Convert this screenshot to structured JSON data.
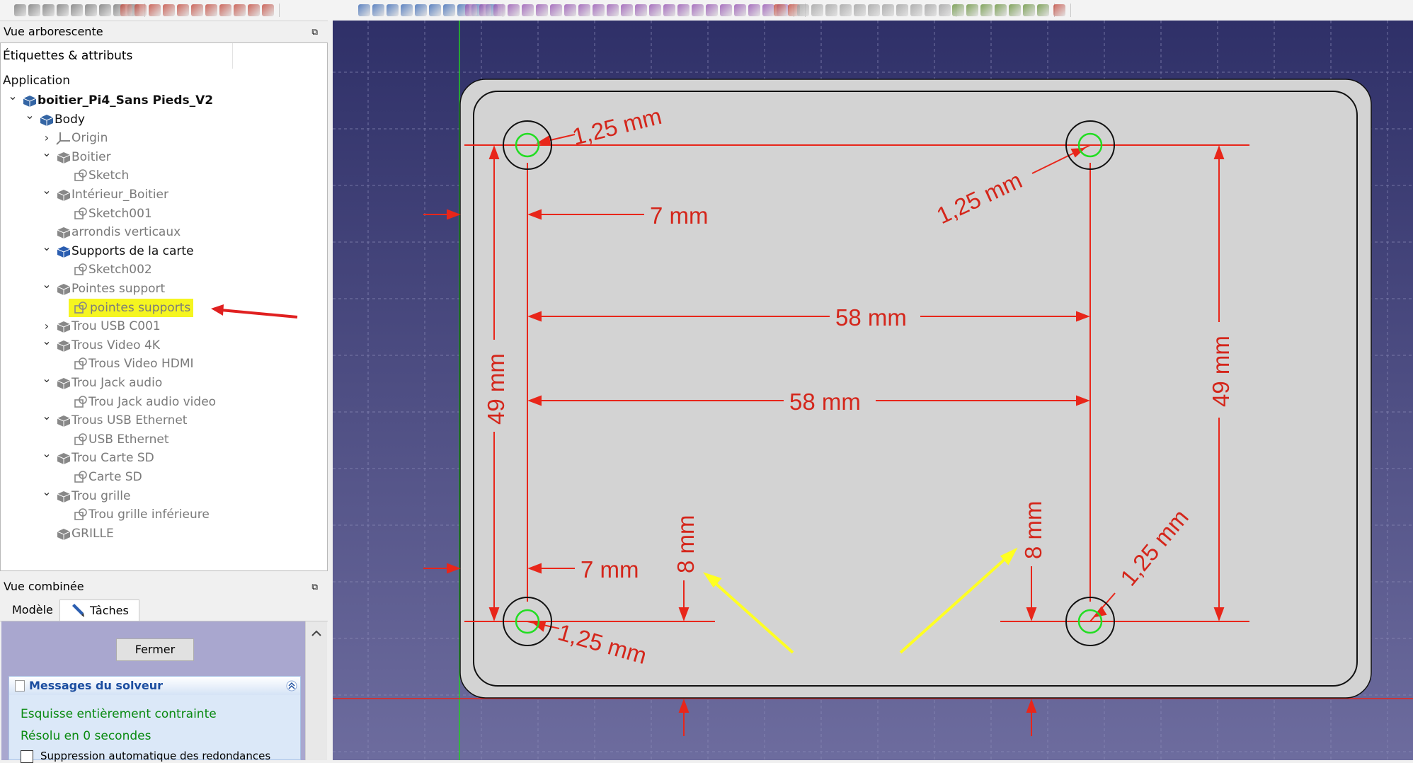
{
  "tree_panel": {
    "title": "Vue arborescente",
    "float_icon": "⧉",
    "column_header": "Étiquettes & attributs",
    "section": "Application"
  },
  "tree": [
    {
      "label": "boitier_Pi4_Sans Pieds_V2",
      "icon": "document-icon",
      "chevron": "down",
      "level": 0,
      "style": "bold"
    },
    {
      "label": "Body",
      "icon": "body-icon",
      "chevron": "down",
      "level": 1,
      "style": "dark"
    },
    {
      "label": "Origin",
      "icon": "origin-icon",
      "chevron": "right",
      "level": 2,
      "style": "dim"
    },
    {
      "label": "Boitier",
      "icon": "pad-icon",
      "chevron": "down",
      "level": 2,
      "style": "dim"
    },
    {
      "label": "Sketch",
      "icon": "sketch-icon",
      "chevron": "",
      "level": 3,
      "style": "dim"
    },
    {
      "label": "Intérieur_Boitier",
      "icon": "pocket-icon",
      "chevron": "down",
      "level": 2,
      "style": "dim"
    },
    {
      "label": "Sketch001",
      "icon": "sketch-icon",
      "chevron": "",
      "level": 3,
      "style": "dim"
    },
    {
      "label": "arrondis verticaux",
      "icon": "fillet-icon",
      "chevron": "",
      "level": 2,
      "style": "dim"
    },
    {
      "label": "Supports de la carte",
      "icon": "pad-active-icon",
      "chevron": "down",
      "level": 2,
      "style": "dark"
    },
    {
      "label": "Sketch002",
      "icon": "sketch-icon",
      "chevron": "",
      "level": 3,
      "style": "dim"
    },
    {
      "label": "Pointes support",
      "icon": "pad-icon",
      "chevron": "down",
      "level": 2,
      "style": "dim"
    },
    {
      "label": "pointes supports",
      "icon": "sketch-edit-icon",
      "chevron": "",
      "level": 3,
      "style": "dim",
      "highlight": true
    },
    {
      "label": "Trou USB C001",
      "icon": "pocket-icon",
      "chevron": "right",
      "level": 2,
      "style": "dim"
    },
    {
      "label": "Trous Video 4K",
      "icon": "pocket-icon",
      "chevron": "down",
      "level": 2,
      "style": "dim"
    },
    {
      "label": "Trous Video HDMI",
      "icon": "sketch-icon",
      "chevron": "",
      "level": 3,
      "style": "dim"
    },
    {
      "label": "Trou Jack audio",
      "icon": "pocket-icon",
      "chevron": "down",
      "level": 2,
      "style": "dim"
    },
    {
      "label": "Trou Jack audio video",
      "icon": "sketch-icon",
      "chevron": "",
      "level": 3,
      "style": "dim"
    },
    {
      "label": "Trous USB Ethernet",
      "icon": "pocket-icon",
      "chevron": "down",
      "level": 2,
      "style": "dim"
    },
    {
      "label": "USB Ethernet",
      "icon": "sketch-icon",
      "chevron": "",
      "level": 3,
      "style": "dim"
    },
    {
      "label": "Trou Carte SD",
      "icon": "pocket-icon",
      "chevron": "down",
      "level": 2,
      "style": "dim"
    },
    {
      "label": "Carte SD",
      "icon": "sketch-icon",
      "chevron": "",
      "level": 3,
      "style": "dim"
    },
    {
      "label": "Trou grille",
      "icon": "pocket-icon",
      "chevron": "down",
      "level": 2,
      "style": "dim"
    },
    {
      "label": "Trou grille inférieure",
      "icon": "sketch-icon",
      "chevron": "",
      "level": 3,
      "style": "dim"
    },
    {
      "label": "GRILLE",
      "icon": "array-icon",
      "chevron": "",
      "level": 2,
      "style": "dim"
    }
  ],
  "combo": {
    "title": "Vue combinée",
    "tabs": [
      "Modèle",
      "Tâches"
    ],
    "close_button": "Fermer"
  },
  "solver": {
    "title": "Messages du solveur",
    "status": "Esquisse entièrement contrainte",
    "time": "Résolu en 0 secondes",
    "checkbox": "Suppression automatique des redondances"
  },
  "sketch": {
    "dimensions": [
      {
        "id": "dia-tl",
        "label": "1,25 mm"
      },
      {
        "id": "dia-tr",
        "label": "1,25 mm"
      },
      {
        "id": "dia-bl",
        "label": "1,25 mm"
      },
      {
        "id": "dia-br",
        "label": "1,25 mm"
      },
      {
        "id": "h-offset-top",
        "label": "7 mm"
      },
      {
        "id": "h-offset-bottom",
        "label": "7 mm"
      },
      {
        "id": "h-span-top",
        "label": "58 mm"
      },
      {
        "id": "h-span-bottom",
        "label": "58 mm"
      },
      {
        "id": "v-span-left",
        "label": "49 mm"
      },
      {
        "id": "v-span-right",
        "label": "49 mm"
      },
      {
        "id": "v-offset-left",
        "label": "8 mm"
      },
      {
        "id": "v-offset-right",
        "label": "8 mm"
      }
    ]
  },
  "colors": {
    "viewport_top": "#2f3068",
    "viewport_bottom": "#6d6c9e",
    "body_fill": "#d3d3d3",
    "dimension": "#e8261a",
    "hole_inner": "#22dd22",
    "highlight": "#f5f520",
    "annotation_arrow": "#ffff22"
  }
}
